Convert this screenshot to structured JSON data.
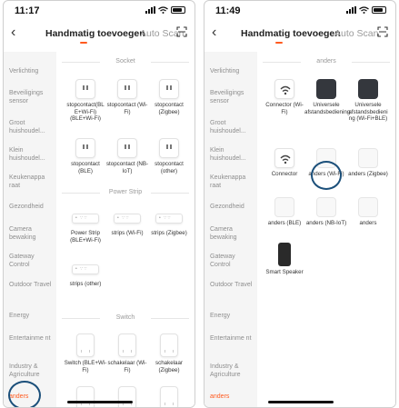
{
  "left": {
    "time": "11:17",
    "tab_active": "Handmatig toevoegen",
    "tab_inactive": "Auto Scan",
    "sidebar": [
      "Verlichting",
      "Beveiligings sensor",
      "Groot huishoudel...",
      "Klein huishoudel...",
      "Keukenappa raat",
      "Gezondheid",
      "Camera bewaking",
      "Gateway Control",
      "Outdoor Travel",
      "Energy",
      "Entertainme nt",
      "Industry & Agriculture",
      "anders"
    ],
    "sections": [
      "Socket",
      "Power Strip",
      "Switch"
    ],
    "socket": [
      "stopcontact(BL E+Wi-Fi) (BLE+Wi-Fi)",
      "stopcontact (Wi-Fi)",
      "stopcontact (Zigbee)",
      "stopcontact (BLE)",
      "stopcontact (NB-IoT)",
      "stopcontact (other)"
    ],
    "strip": [
      "Power Strip (BLE+Wi-Fi)",
      "strips (Wi-Fi)",
      "strips (Zigbee)",
      "strips (other)"
    ],
    "switch": [
      "Switch (BLE+Wi-Fi)",
      "schakelaar (Wi-Fi)",
      "schakelaar (Zigbee)"
    ]
  },
  "right": {
    "time": "11:49",
    "tab_active": "Handmatig toevoegen",
    "tab_inactive": "Auto Scan",
    "sidebar": [
      "Verlichting",
      "Beveiligings sensor",
      "Groot huishoudel...",
      "Klein huishoudel...",
      "Keukenappa raat",
      "Gezondheid",
      "Camera bewaking",
      "Gateway Control",
      "Outdoor Travel",
      "Energy",
      "Entertainme nt",
      "Industry & Agriculture",
      "anders"
    ],
    "section": "anders",
    "devices": [
      "Connector (Wi-Fi)",
      "Universele afstandsbediening",
      "Universele afstandsbedieni ng (Wi-Fi+BLE)",
      "Connector",
      "anders (Wi-Fi)",
      "anders (Zigbee)",
      "anders (BLE)",
      "anders (NB-IoT)",
      "anders",
      "Smart Speaker"
    ]
  },
  "colors": {
    "accent": "#ff5a1f",
    "highlight_ring": "#1b4f7a"
  }
}
